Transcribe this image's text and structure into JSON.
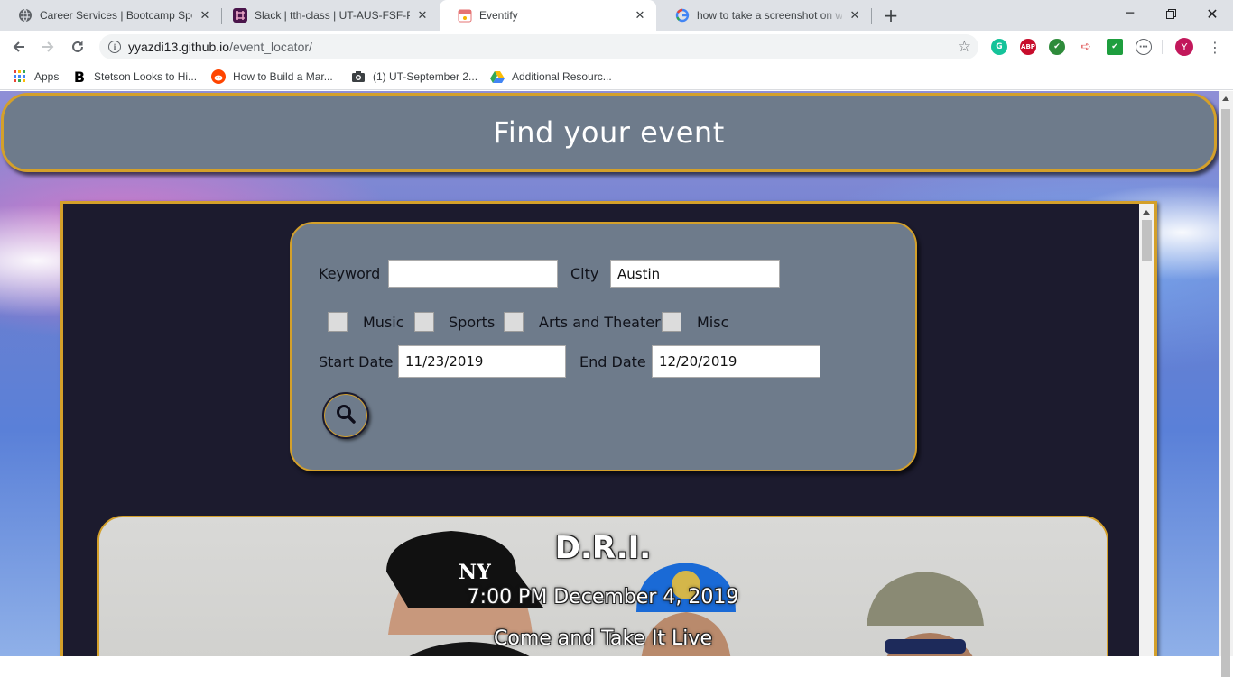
{
  "browser": {
    "tabs": [
      {
        "title": "Career Services | Bootcamp Spot",
        "active": false
      },
      {
        "title": "Slack | tth-class | UT-AUS-FSF-PT",
        "active": false
      },
      {
        "title": "Eventify",
        "active": true
      },
      {
        "title": "how to take a screenshot on windows",
        "active": false
      }
    ],
    "address": {
      "host": "yyazdi13.github.io",
      "path": "/event_locator/"
    },
    "profile_initial": "Y",
    "bookmarks": [
      {
        "label": "Apps",
        "icon": "apps-grid-icon"
      },
      {
        "label": "Stetson Looks to Hi...",
        "icon": "bold-b-icon"
      },
      {
        "label": "How to Build a Mar...",
        "icon": "reddit-icon"
      },
      {
        "label": "(1) UT-September 2...",
        "icon": "camera-icon"
      },
      {
        "label": "Additional Resourc...",
        "icon": "drive-icon"
      }
    ],
    "extensions": [
      "grammarly-icon",
      "adblock-icon",
      "check-icon",
      "arrow-ext-icon",
      "task-check-icon",
      "clock-ext-icon"
    ]
  },
  "page": {
    "heading": "Find your event",
    "form": {
      "keyword_label": "Keyword",
      "keyword_value": "",
      "city_label": "City",
      "city_value": "Austin",
      "categories": [
        "Music",
        "Sports",
        "Arts and Theater",
        "Misc"
      ],
      "start_label": "Start Date",
      "start_value": "11/23/2019",
      "end_label": "End Date",
      "end_value": "12/20/2019",
      "search_icon": "search-icon"
    },
    "event": {
      "name": "D.R.I.",
      "datetime": "7:00 PM December 4, 2019",
      "venue": "Come and Take It Live"
    }
  },
  "colors": {
    "panel": "#6e7b8b",
    "accent_border": "#d4a02a",
    "main_bg": "#1c1b2e"
  }
}
